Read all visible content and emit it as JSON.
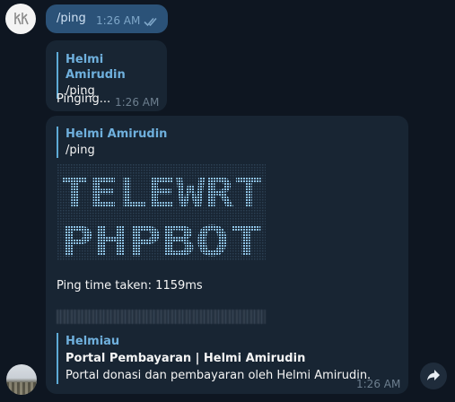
{
  "outgoing": {
    "text": "/ping",
    "time": "1:26 AM",
    "status_icon": "double-check-icon"
  },
  "ping_reply": {
    "reply_author": "Helmi Amirudin",
    "reply_text": "/ping",
    "text": "Pinging...",
    "time": "1:26 AM"
  },
  "result_message": {
    "reply_author": "Helmi Amirudin",
    "reply_text": "/ping",
    "ascii_art_lines": [
      "TELEWRT",
      "PHPBOT"
    ],
    "ping_text": "Ping time taken: 1159ms",
    "link_preview": {
      "site_name": "Helmiau",
      "title": "Portal Pembayaran | Helmi Amirudin",
      "description": "Portal donasi dan pembayaran oleh Helmi Amirudin."
    },
    "time": "1:26 AM"
  },
  "colors": {
    "background": "#0e1621",
    "outgoing_bubble": "#2b5278",
    "incoming_bubble": "#182533",
    "accent": "#6fb0dd"
  }
}
